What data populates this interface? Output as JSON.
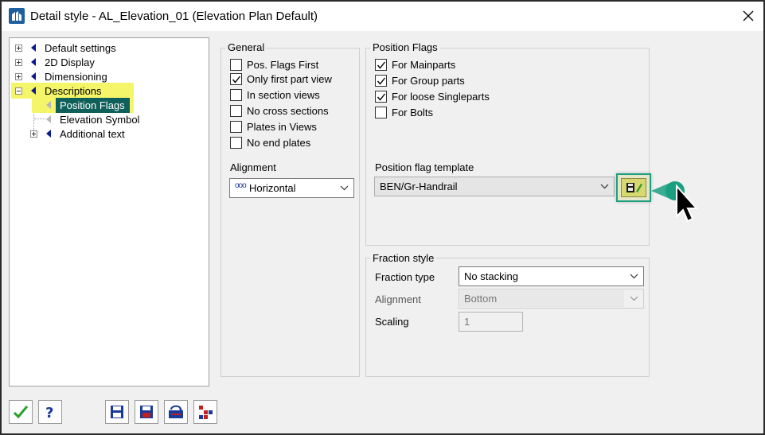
{
  "window": {
    "title": "Detail style - AL_Elevation_01 (Elevation Plan Default)"
  },
  "tree": {
    "items": [
      {
        "label": "Default settings"
      },
      {
        "label": "2D Display"
      },
      {
        "label": "Dimensioning"
      },
      {
        "label": "Descriptions"
      },
      {
        "label": "Position Flags"
      },
      {
        "label": "Elevation Symbol"
      },
      {
        "label": "Additional text"
      }
    ]
  },
  "general": {
    "title": "General",
    "checkboxes": [
      {
        "label": "Pos. Flags First",
        "checked": false
      },
      {
        "label": "Only first part view",
        "checked": true
      },
      {
        "label": "In section views",
        "checked": false
      },
      {
        "label": "No cross sections",
        "checked": false
      },
      {
        "label": "Plates in Views",
        "checked": false
      },
      {
        "label": "No end plates",
        "checked": false
      }
    ],
    "alignment_label": "Alignment",
    "alignment_value": "Horizontal",
    "alignment_icon": "ooo"
  },
  "position_flags": {
    "title": "Position Flags",
    "checkboxes": [
      {
        "label": "For Mainparts",
        "checked": true
      },
      {
        "label": "For Group parts",
        "checked": true
      },
      {
        "label": "For loose Singleparts",
        "checked": true
      },
      {
        "label": "For Bolts",
        "checked": false
      }
    ],
    "template_label": "Position flag template",
    "template_value": "BEN/Gr-Handrail"
  },
  "fraction_style": {
    "title": "Fraction style",
    "fraction_type_label": "Fraction type",
    "fraction_type_value": "No stacking",
    "alignment_label": "Alignment",
    "alignment_value": "Bottom",
    "scaling_label": "Scaling",
    "scaling_value": "1"
  },
  "colors": {
    "highlight": "#f5f56a",
    "selection": "#0f5f5a",
    "callout": "#1aa080"
  }
}
